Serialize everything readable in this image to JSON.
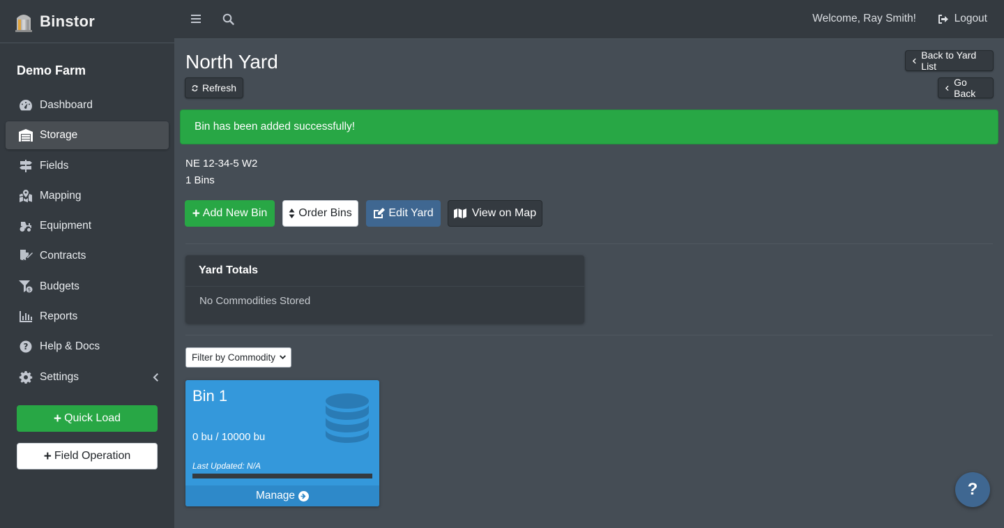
{
  "brand": {
    "name": "Binstor"
  },
  "sidebar": {
    "farm_name": "Demo Farm",
    "items": [
      {
        "label": "Dashboard",
        "icon": "tachometer-icon"
      },
      {
        "label": "Storage",
        "icon": "warehouse-icon",
        "active": true
      },
      {
        "label": "Fields",
        "icon": "signpost-icon"
      },
      {
        "label": "Mapping",
        "icon": "map-marked-icon"
      },
      {
        "label": "Equipment",
        "icon": "tractor-icon"
      },
      {
        "label": "Contracts",
        "icon": "file-signature-icon"
      },
      {
        "label": "Budgets",
        "icon": "funnel-dollar-icon"
      },
      {
        "label": "Reports",
        "icon": "chart-bar-icon"
      },
      {
        "label": "Help & Docs",
        "icon": "question-circle-icon"
      },
      {
        "label": "Settings",
        "icon": "gear-icon"
      }
    ],
    "quick_load": "Quick Load",
    "field_operation": "Field Operation"
  },
  "topbar": {
    "welcome": "Welcome, Ray Smith!",
    "logout": "Logout"
  },
  "page": {
    "title": "North Yard",
    "refresh": "Refresh",
    "back_to_yard_list": "Back to Yard List",
    "go_back": "Go Back",
    "alert": "Bin has been added successfully!",
    "location": "NE 12-34-5 W2",
    "bin_count": "1 Bins",
    "actions": {
      "add_new_bin": "Add New Bin",
      "order_bins": "Order Bins",
      "edit_yard": "Edit Yard",
      "view_on_map": "View on Map"
    },
    "yard_totals": {
      "title": "Yard Totals",
      "body": "No Commodities Stored"
    },
    "filter": "Filter by Commodity",
    "bins": [
      {
        "name": "Bin 1",
        "capacity": "0 bu / 10000 bu",
        "last_updated": "Last Updated: N/A",
        "fill_fraction": 0,
        "manage": "Manage"
      }
    ]
  },
  "help_fab": "?",
  "colors": {
    "sidebar_bg": "#343a40",
    "content_bg": "#454d55",
    "success": "#28a745",
    "bin_card": "#3498db",
    "edit_button": "#3f6791"
  }
}
